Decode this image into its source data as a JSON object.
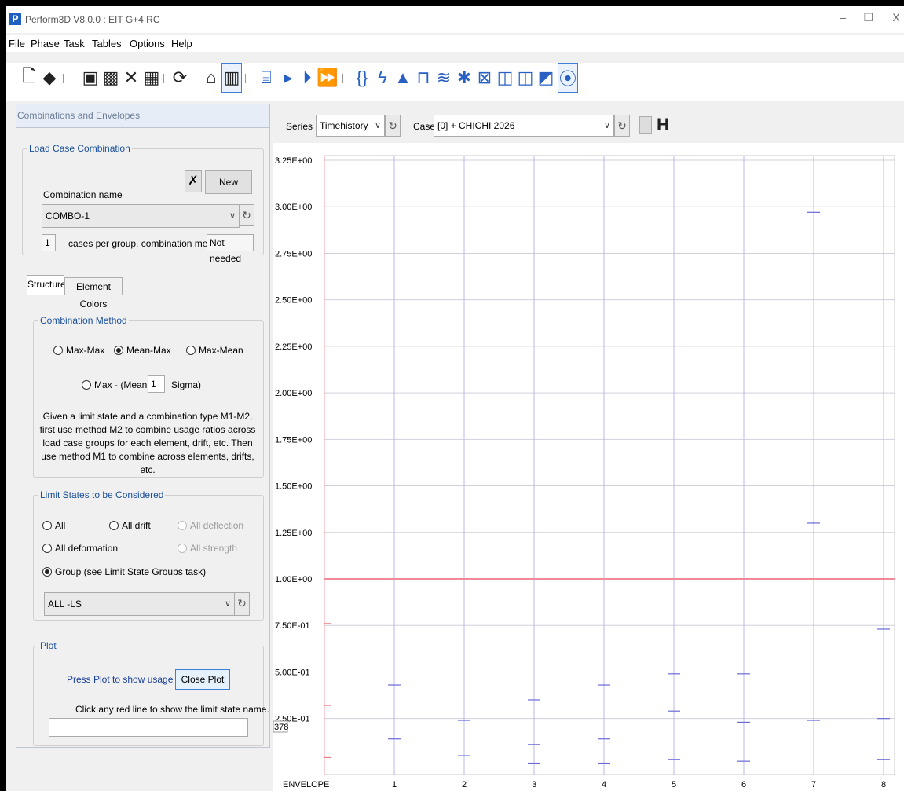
{
  "window": {
    "title": "Perform3D V8.0.0 : EIT G+4 RC",
    "logo_letter": "P",
    "controls": {
      "minimize": "–",
      "restore": "❐",
      "close": "X"
    }
  },
  "menu": [
    "File",
    "Phase",
    "Task",
    "Tables",
    "Options",
    "Help"
  ],
  "toolbar_icons": [
    "new-file-icon",
    "open-icon",
    "save-icon",
    "save-as-icon",
    "delete-icon",
    "table-icon",
    "refresh-icon",
    "structure-icon",
    "analysis-icon",
    "frame-icon",
    "play-icon",
    "step-icon",
    "fast-forward-icon",
    "brace-icon",
    "lightning-icon",
    "thumbs-icon",
    "portal-icon",
    "ground-motion-icon",
    "spring-icon",
    "damper-icon",
    "graph-icon",
    "graph2-icon",
    "graph3-icon",
    "target-icon"
  ],
  "left_panel": {
    "header": "Combinations and Envelopes",
    "load_case_combination": {
      "legend": "Load Case Combination",
      "delete_glyph": "✗",
      "new_label": "New",
      "name_label": "Combination name",
      "name_value": "COMBO-1",
      "cases_value": "1",
      "cases_text": "cases per group, combination method =",
      "method_value": "Not needed"
    },
    "tabs": [
      "Structure",
      "Element Colors"
    ],
    "combination_method": {
      "legend": "Combination Method",
      "options": [
        "Max-Max",
        "Mean-Max",
        "Max-Mean"
      ],
      "selected": "Mean-Max",
      "sigma_prefix": "Max - (Mean +",
      "sigma_value": "1",
      "sigma_suffix": "Sigma)",
      "description": "Given a limit state and a combination type M1-M2, first use method M2 to combine usage ratios across load case groups for each element, drift, etc. Then use method M1 to combine across elements, drifts, etc."
    },
    "limit_states": {
      "legend": "Limit States to be Considered",
      "all": "All",
      "all_drift": "All drift",
      "all_deflection": "All deflection",
      "all_deformation": "All deformation",
      "all_strength": "All strength",
      "group": "Group (see Limit State Groups task)",
      "group_value": "ALL -LS"
    },
    "plot": {
      "legend": "Plot",
      "hint": "Press Plot to show usage ratios.",
      "close_label": "Close Plot",
      "click_hint": "Click any red line to show the limit state name.",
      "name_value": ""
    }
  },
  "chart_controls": {
    "series_label": "Series",
    "series_value": "Timehistory",
    "case_label": "Case",
    "case_value": "[0] + CHICHI 2026"
  },
  "chart_data": {
    "type": "scatter",
    "x_labels": [
      "ENVELOPE",
      "1",
      "2",
      "3",
      "4",
      "5",
      "6",
      "7",
      "8"
    ],
    "y_ticks": [
      "3.25E+00",
      "3.00E+00",
      "2.75E+00",
      "2.50E+00",
      "2.25E+00",
      "2.00E+00",
      "1.75E+00",
      "1.50E+00",
      "1.25E+00",
      "1.00E+00",
      "7.50E-01",
      "5.00E-01",
      "2.50E-01"
    ],
    "ylim": [
      0,
      3.25
    ],
    "limit_line": 1.0,
    "cursor_readout": "378",
    "markers": [
      {
        "x": "ENVELOPE",
        "y": 0.76,
        "color": "red"
      },
      {
        "x": "ENVELOPE",
        "y": 0.32,
        "color": "red"
      },
      {
        "x": "ENVELOPE",
        "y": 0.04,
        "color": "red"
      },
      {
        "x": "1",
        "y": 0.43
      },
      {
        "x": "1",
        "y": 0.14
      },
      {
        "x": "2",
        "y": 0.24
      },
      {
        "x": "2",
        "y": 0.05
      },
      {
        "x": "3",
        "y": 0.35
      },
      {
        "x": "3",
        "y": 0.11
      },
      {
        "x": "3",
        "y": 0.01
      },
      {
        "x": "4",
        "y": 0.43
      },
      {
        "x": "4",
        "y": 0.14
      },
      {
        "x": "4",
        "y": 0.01
      },
      {
        "x": "5",
        "y": 0.49
      },
      {
        "x": "5",
        "y": 0.29
      },
      {
        "x": "5",
        "y": 0.03
      },
      {
        "x": "6",
        "y": 0.49
      },
      {
        "x": "6",
        "y": 0.23
      },
      {
        "x": "6",
        "y": 0.02
      },
      {
        "x": "7",
        "y": 2.97
      },
      {
        "x": "7",
        "y": 1.3
      },
      {
        "x": "7",
        "y": 0.24
      },
      {
        "x": "8",
        "y": 0.73
      },
      {
        "x": "8",
        "y": 0.25
      },
      {
        "x": "8",
        "y": 0.03
      }
    ],
    "grid": true
  }
}
